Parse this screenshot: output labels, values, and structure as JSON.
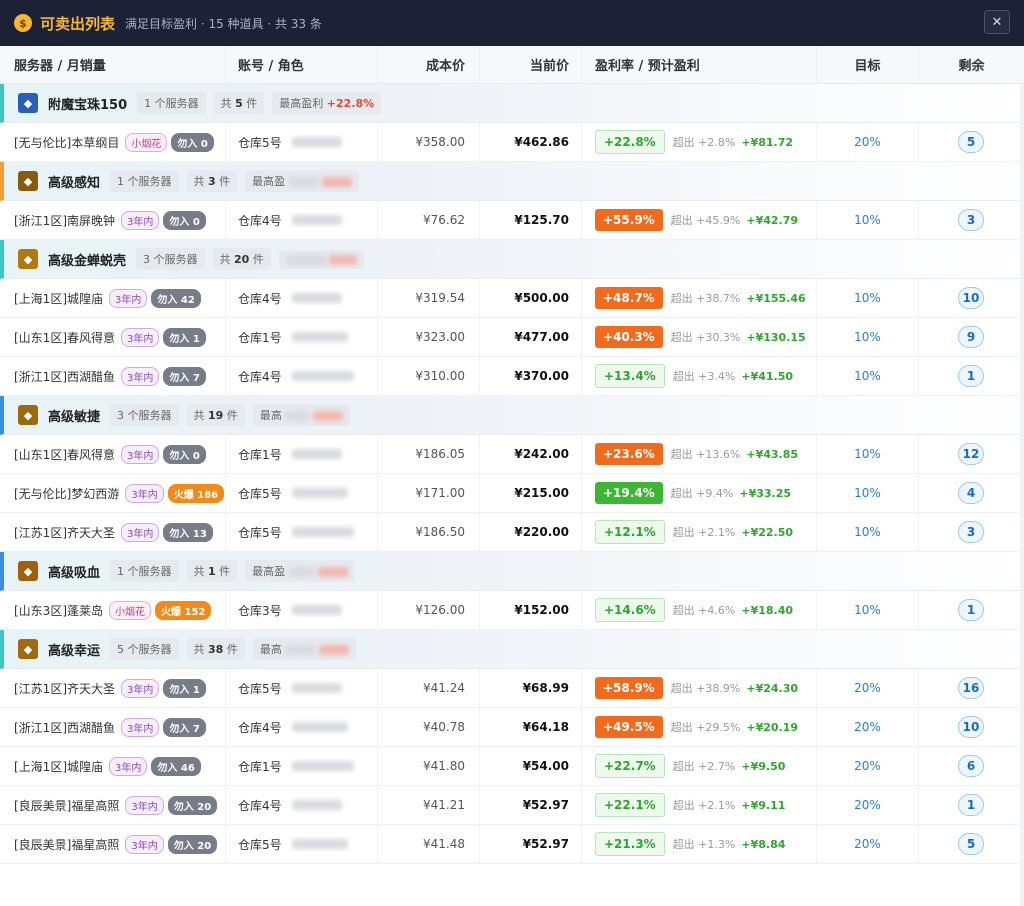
{
  "header": {
    "icon_glyph": "$",
    "title": "可卖出列表",
    "subtitle": "满足目标盈利 · 15 种道具 · 共 33 条",
    "close_label": "✕"
  },
  "columns": [
    "服务器 / 月销量",
    "账号 / 角色",
    "成本价",
    "当前价",
    "盈利率 / 预计盈利",
    "目标",
    "剩余"
  ],
  "groups": [
    {
      "name": "附魔宝珠150",
      "icon": "orb-icon",
      "icon_color": "#2a5fb8",
      "servers": "1 个服务器",
      "count_prefix": "共",
      "count": "5",
      "count_suffix": "件",
      "max_label": "最高盈利",
      "max_value": "+22.8%",
      "rows": [
        {
          "server": "[无与伦比]本草纲目",
          "tag": "小烟花",
          "tag_style": "pink",
          "sales": "勿入 0",
          "sales_style": "gray",
          "account": "仓库5号",
          "cost": "¥358.00",
          "price": "¥462.86",
          "pct": "+22.8%",
          "pct_style": "green-soft",
          "over": "超出 +2.8%",
          "profit": "+¥81.72",
          "target": "20%",
          "remain": "5"
        }
      ]
    },
    {
      "name": "高级感知",
      "icon": "eye-icon",
      "icon_color": "#8a5a10",
      "servers": "1 个服务器",
      "count_prefix": "共",
      "count": "3",
      "count_suffix": "件",
      "max_label": "最高盈",
      "rows": [
        {
          "server": "[浙江1区]南屏晚钟",
          "tag": "3年内",
          "tag_style": "purple",
          "sales": "勿入 0",
          "sales_style": "gray",
          "account": "仓库4号",
          "cost": "¥76.62",
          "price": "¥125.70",
          "pct": "+55.9%",
          "pct_style": "orange",
          "over": "超出 +45.9%",
          "profit": "+¥42.79",
          "target": "10%",
          "remain": "3"
        }
      ]
    },
    {
      "name": "高级金蝉蜕壳",
      "icon": "cicada-icon",
      "icon_color": "#b07a10",
      "servers": "3 个服务器",
      "count_prefix": "共",
      "count": "20",
      "count_suffix": "件",
      "max_label": "",
      "rows": [
        {
          "server": "[上海1区]城隍庙",
          "tag": "3年内",
          "tag_style": "purple",
          "sales": "勿入 42",
          "sales_style": "gray",
          "account": "仓库4号",
          "cost": "¥319.54",
          "price": "¥500.00",
          "pct": "+48.7%",
          "pct_style": "orange",
          "over": "超出 +38.7%",
          "profit": "+¥155.46",
          "target": "10%",
          "remain": "10"
        },
        {
          "server": "[山东1区]春风得意",
          "tag": "3年内",
          "tag_style": "purple",
          "sales": "勿入 1",
          "sales_style": "gray",
          "account": "仓库1号",
          "cost": "¥323.00",
          "price": "¥477.00",
          "pct": "+40.3%",
          "pct_style": "orange",
          "over": "超出 +30.3%",
          "profit": "+¥130.15",
          "target": "10%",
          "remain": "9"
        },
        {
          "server": "[浙江1区]西湖醋鱼",
          "tag": "3年内",
          "tag_style": "purple",
          "sales": "勿入 7",
          "sales_style": "gray",
          "account": "仓库4号",
          "cost": "¥310.00",
          "price": "¥370.00",
          "pct": "+13.4%",
          "pct_style": "green-soft",
          "over": "超出 +3.4%",
          "profit": "+¥41.50",
          "target": "10%",
          "remain": "1"
        }
      ]
    },
    {
      "name": "高级敏捷",
      "icon": "agility-icon",
      "icon_color": "#9a6a10",
      "servers": "3 个服务器",
      "count_prefix": "共",
      "count": "19",
      "count_suffix": "件",
      "max_label": "最高",
      "rows": [
        {
          "server": "[山东1区]春风得意",
          "tag": "3年内",
          "tag_style": "purple",
          "sales": "勿入 0",
          "sales_style": "gray",
          "account": "仓库1号",
          "cost": "¥186.05",
          "price": "¥242.00",
          "pct": "+23.6%",
          "pct_style": "orange",
          "over": "超出 +13.6%",
          "profit": "+¥43.85",
          "target": "10%",
          "remain": "12"
        },
        {
          "server": "[无与伦比]梦幻西游",
          "tag": "3年内",
          "tag_style": "purple",
          "sales": "火爆 186",
          "sales_style": "fire",
          "account": "仓库5号",
          "cost": "¥171.00",
          "price": "¥215.00",
          "pct": "+19.4%",
          "pct_style": "green",
          "over": "超出 +9.4%",
          "profit": "+¥33.25",
          "target": "10%",
          "remain": "4"
        },
        {
          "server": "[江苏1区]齐天大圣",
          "tag": "3年内",
          "tag_style": "purple",
          "sales": "勿入 13",
          "sales_style": "gray",
          "account": "仓库5号",
          "cost": "¥186.50",
          "price": "¥220.00",
          "pct": "+12.1%",
          "pct_style": "green-soft",
          "over": "超出 +2.1%",
          "profit": "+¥22.50",
          "target": "10%",
          "remain": "3"
        }
      ]
    },
    {
      "name": "高级吸血",
      "icon": "bloodsuck-icon",
      "icon_color": "#a0600c",
      "servers": "1 个服务器",
      "count_prefix": "共",
      "count": "1",
      "count_suffix": "件",
      "max_label": "最高盈",
      "rows": [
        {
          "server": "[山东3区]蓬莱岛",
          "tag": "小烟花",
          "tag_style": "pink",
          "sales": "火爆 152",
          "sales_style": "fire",
          "account": "仓库3号",
          "cost": "¥126.00",
          "price": "¥152.00",
          "pct": "+14.6%",
          "pct_style": "green-soft",
          "over": "超出 +4.6%",
          "profit": "+¥18.40",
          "target": "10%",
          "remain": "1"
        }
      ]
    },
    {
      "name": "高级幸运",
      "icon": "luck-icon",
      "icon_color": "#a06a10",
      "servers": "5 个服务器",
      "count_prefix": "共",
      "count": "38",
      "count_suffix": "件",
      "max_label": "最高",
      "rows": [
        {
          "server": "[江苏1区]齐天大圣",
          "tag": "3年内",
          "tag_style": "purple",
          "sales": "勿入 1",
          "sales_style": "gray",
          "account": "仓库5号",
          "cost": "¥41.24",
          "price": "¥68.99",
          "pct": "+58.9%",
          "pct_style": "orange",
          "over": "超出 +38.9%",
          "profit": "+¥24.30",
          "target": "20%",
          "remain": "16"
        },
        {
          "server": "[浙江1区]西湖醋鱼",
          "tag": "3年内",
          "tag_style": "purple",
          "sales": "勿入 7",
          "sales_style": "gray",
          "account": "仓库4号",
          "cost": "¥40.78",
          "price": "¥64.18",
          "pct": "+49.5%",
          "pct_style": "orange",
          "over": "超出 +29.5%",
          "profit": "+¥20.19",
          "target": "20%",
          "remain": "10"
        },
        {
          "server": "[上海1区]城隍庙",
          "tag": "3年内",
          "tag_style": "purple",
          "sales": "勿入 46",
          "sales_style": "gray",
          "account": "仓库1号",
          "cost": "¥41.80",
          "price": "¥54.00",
          "pct": "+22.7%",
          "pct_style": "green-soft",
          "over": "超出 +2.7%",
          "profit": "+¥9.50",
          "target": "20%",
          "remain": "6"
        },
        {
          "server": "[良辰美景]福星高照",
          "tag": "3年内",
          "tag_style": "purple",
          "sales": "勿入 20",
          "sales_style": "gray",
          "account": "仓库4号",
          "cost": "¥41.21",
          "price": "¥52.97",
          "pct": "+22.1%",
          "pct_style": "green-soft",
          "over": "超出 +2.1%",
          "profit": "+¥9.11",
          "target": "20%",
          "remain": "1"
        },
        {
          "server": "[良辰美景]福星高照",
          "tag": "3年内",
          "tag_style": "purple",
          "sales": "勿入 20",
          "sales_style": "gray",
          "account": "仓库5号",
          "cost": "¥41.48",
          "price": "¥52.97",
          "pct": "+21.3%",
          "pct_style": "green-soft",
          "over": "超出 +1.3%",
          "profit": "+¥8.84",
          "target": "20%",
          "remain": "5"
        }
      ]
    }
  ]
}
